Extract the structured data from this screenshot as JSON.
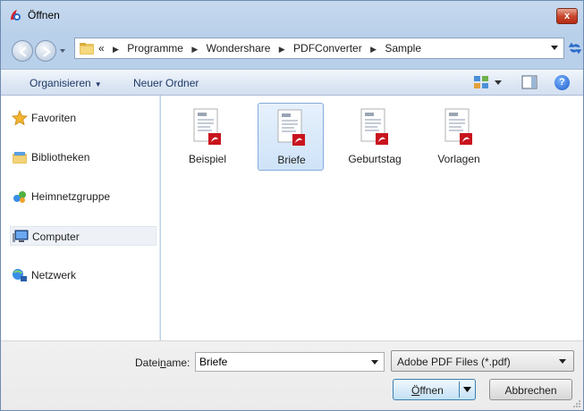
{
  "window": {
    "title": "Öffnen",
    "close_label": "x"
  },
  "address": {
    "prefix": "«",
    "breadcrumbs": [
      "Programme",
      "Wondershare",
      "PDFConverter",
      "Sample"
    ]
  },
  "toolbar": {
    "organize_label": "Organisieren",
    "new_folder_label": "Neuer Ordner",
    "help_label": "?"
  },
  "navpane": {
    "items": [
      {
        "label": "Favoriten",
        "icon": "star-icon"
      },
      {
        "label": "Bibliotheken",
        "icon": "library-icon"
      },
      {
        "label": "Heimnetzgruppe",
        "icon": "homegroup-icon"
      },
      {
        "label": "Computer",
        "icon": "computer-icon",
        "selected": true
      },
      {
        "label": "Netzwerk",
        "icon": "network-icon"
      }
    ]
  },
  "files": [
    {
      "label": "Beispiel",
      "icon": "pdf-file-icon"
    },
    {
      "label": "Briefe",
      "icon": "pdf-file-icon",
      "selected": true
    },
    {
      "label": "Geburtstag",
      "icon": "pdf-file-icon"
    },
    {
      "label": "Vorlagen",
      "icon": "pdf-file-icon"
    }
  ],
  "bottom": {
    "filename_label_pre": "Datei",
    "filename_label_accel": "n",
    "filename_label_post": "ame:",
    "filename_value": "Briefe",
    "filter_value": "Adobe PDF Files (*.pdf)",
    "open_label_accel": "Ö",
    "open_label_rest": "ffnen",
    "cancel_label": "Abbrechen"
  },
  "colors": {
    "accent": "#3c7fb1",
    "selection": "#cfe3f8",
    "pdf_red": "#c8141e"
  }
}
